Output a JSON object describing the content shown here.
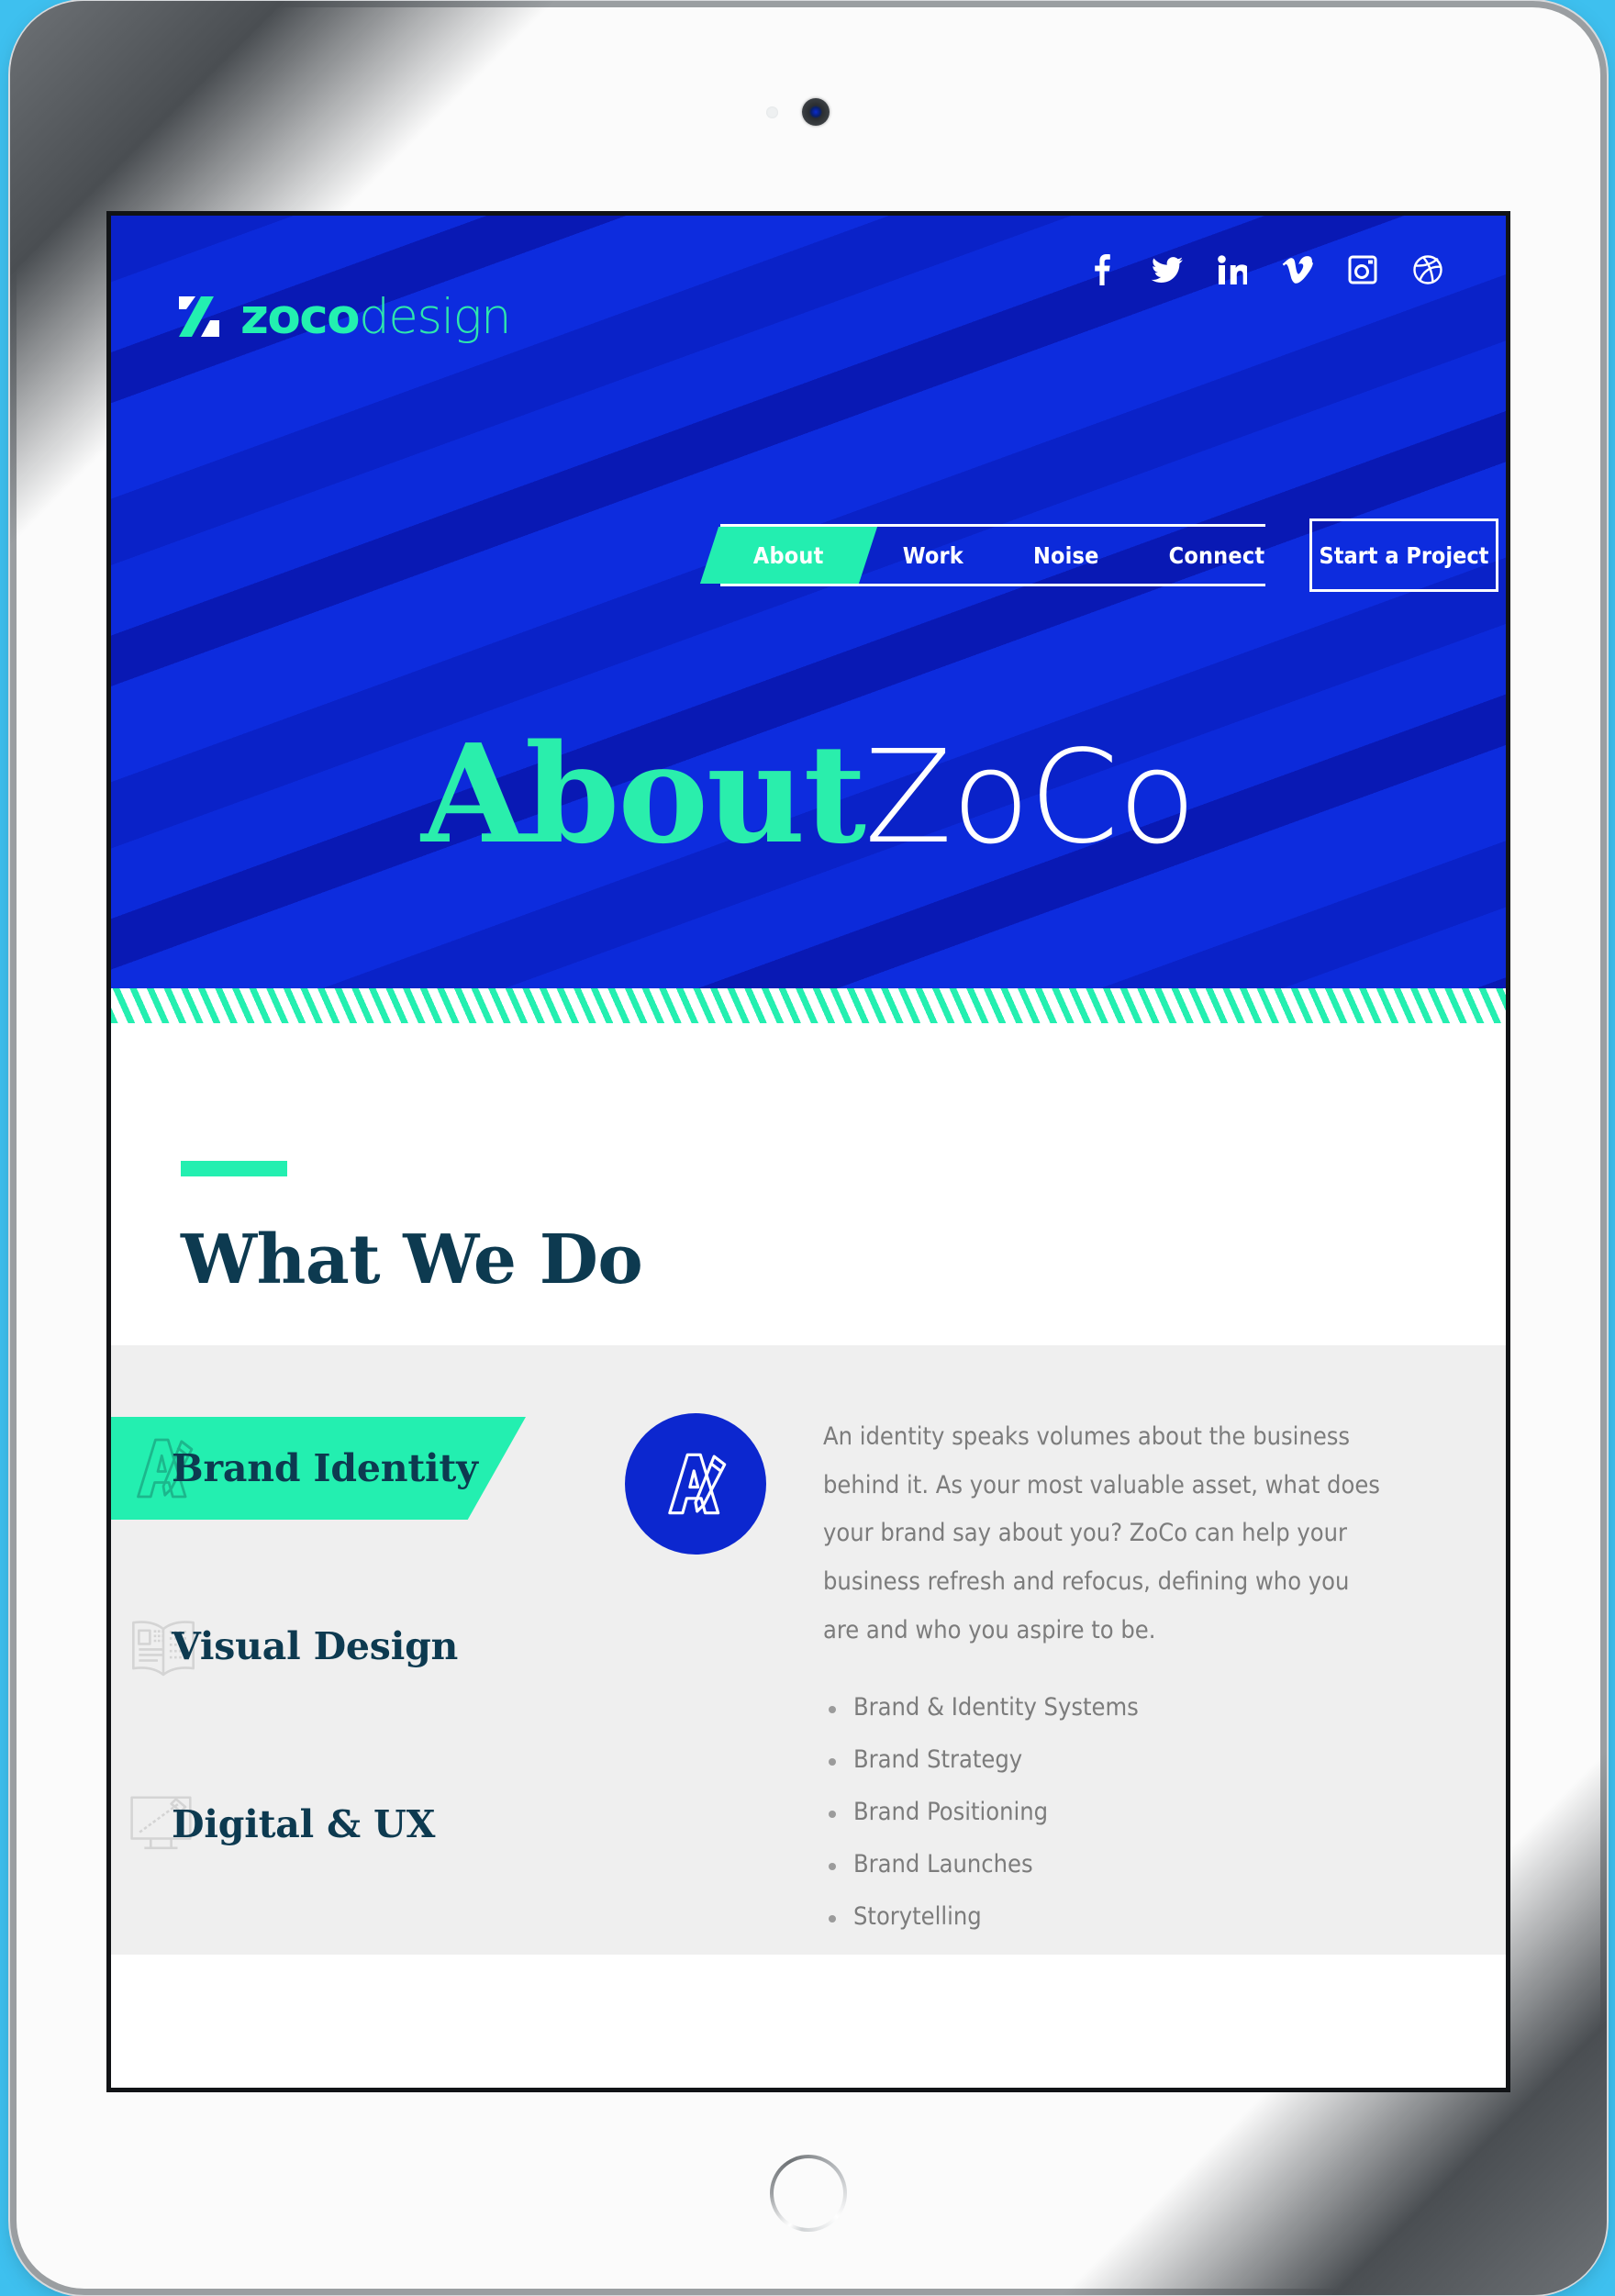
{
  "device": {
    "type": "tablet",
    "camera_icon": "camera-lens",
    "sensor_icon": "ambient-light-sensor",
    "home_button_icon": "home-button"
  },
  "colors": {
    "background": "#3ec0ef",
    "brand_blue": "#0b24cf",
    "brand_green": "#23efb0",
    "heading_navy": "#0d3a50",
    "body_grey": "#7c7c7c",
    "panel_grey": "#efefef"
  },
  "header": {
    "logo": {
      "mark_icon": "zoco-z-mark",
      "text_bold": "zoco",
      "text_light": "design"
    },
    "social": [
      {
        "name": "facebook-icon",
        "label": "Facebook"
      },
      {
        "name": "twitter-icon",
        "label": "Twitter"
      },
      {
        "name": "linkedin-icon",
        "label": "LinkedIn"
      },
      {
        "name": "vimeo-icon",
        "label": "Vimeo"
      },
      {
        "name": "instagram-icon",
        "label": "Instagram"
      },
      {
        "name": "dribbble-icon",
        "label": "Dribbble"
      }
    ],
    "nav": [
      {
        "label": "About",
        "active": true
      },
      {
        "label": "Work",
        "active": false
      },
      {
        "label": "Noise",
        "active": false
      },
      {
        "label": "Connect",
        "active": false
      }
    ],
    "cta_label": "Start a Project"
  },
  "hero": {
    "title_bold": "About",
    "title_light": "ZoCo"
  },
  "what_we_do": {
    "accent_bar": true,
    "title": "What We Do"
  },
  "services": {
    "tabs": [
      {
        "label": "Brand Identity",
        "icon": "letter-a-pencil-icon",
        "active": true
      },
      {
        "label": "Visual Design",
        "icon": "open-magazine-icon",
        "active": false
      },
      {
        "label": "Digital & UX",
        "icon": "desktop-monitor-icon",
        "active": false
      }
    ],
    "detail": {
      "badge_icon": "letter-a-pencil-icon",
      "paragraph": "An identity speaks volumes about the business behind it. As your most valuable asset, what does your brand say about you? ZoCo can help your business refresh and refocus, defining who you are and who you aspire to be.",
      "list": [
        "Brand & Identity Systems",
        "Brand Strategy",
        "Brand Positioning",
        "Brand Launches",
        "Storytelling"
      ]
    }
  }
}
